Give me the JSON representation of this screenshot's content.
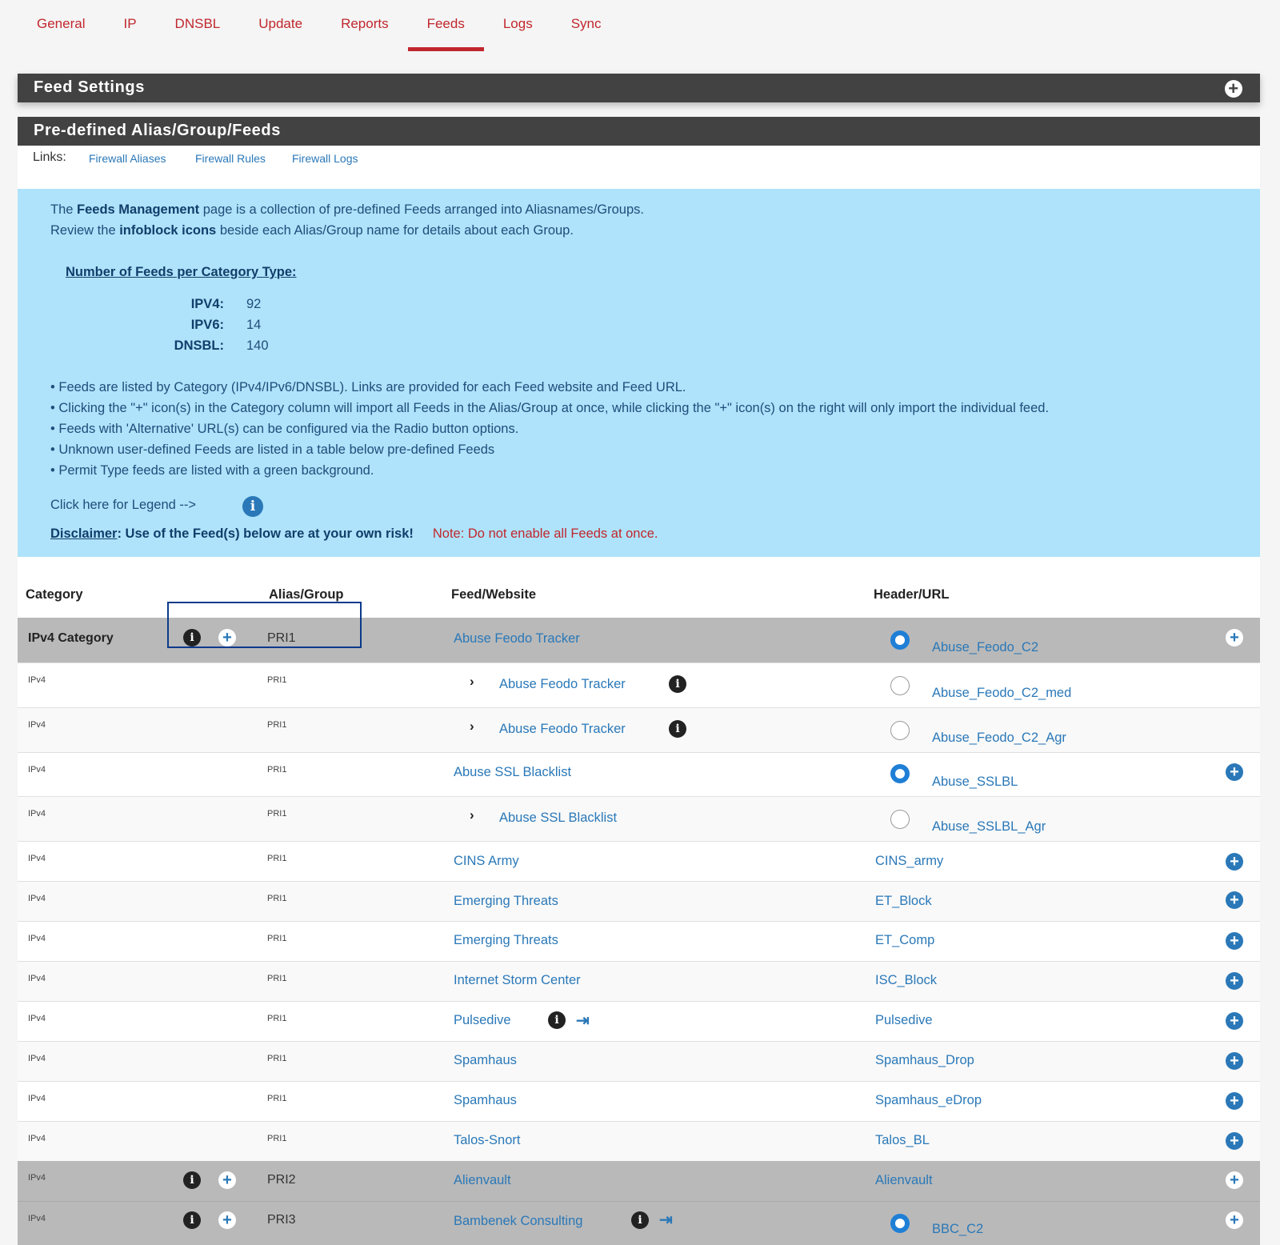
{
  "tabs": [
    {
      "label": "General",
      "active": false
    },
    {
      "label": "IP",
      "active": false
    },
    {
      "label": "DNSBL",
      "active": false
    },
    {
      "label": "Update",
      "active": false
    },
    {
      "label": "Reports",
      "active": false
    },
    {
      "label": "Feeds",
      "active": true
    },
    {
      "label": "Logs",
      "active": false
    },
    {
      "label": "Sync",
      "active": false
    }
  ],
  "feed_settings": {
    "title": "Feed Settings"
  },
  "predef": {
    "title": "Pre-defined Alias/Group/Feeds",
    "links_label": "Links:",
    "links": [
      "Firewall Aliases",
      "Firewall Rules",
      "Firewall Logs"
    ]
  },
  "info": {
    "l1a": "The ",
    "l1b": "Feeds Management",
    "l1c": " page is a collection of pre-defined Feeds arranged into Aliasnames/Groups.",
    "l2a": "Review the ",
    "l2b": "infoblock icons",
    "l2c": " beside each Alias/Group name for details about each Group.",
    "count_title": "Number of Feeds per Category Type:",
    "counts": [
      {
        "label": "IPV4:",
        "value": "92"
      },
      {
        "label": "IPV6:",
        "value": "14"
      },
      {
        "label": "DNSBL:",
        "value": "140"
      }
    ],
    "bullets": [
      "• Feeds are listed by Category (IPv4/IPv6/DNSBL). Links are provided for each Feed website and Feed URL.",
      "• Clicking the \"+\" icon(s) in the Category column will import all Feeds in the Alias/Group at once, while clicking the \"+\" icon(s) on the right will only import the individual feed.",
      "• Feeds with 'Alternative' URL(s) can be configured via the Radio button options.",
      "• Unknown user-defined Feeds are listed in a table below pre-defined Feeds",
      "• Permit Type feeds are listed with a green background."
    ],
    "legend": "Click here for Legend  -->",
    "disclaimer_a": "Disclaimer",
    "disclaimer_b": ": Use of the Feed(s) below are at your own risk!",
    "note": "Note: Do not enable all Feeds at once."
  },
  "table": {
    "headers": [
      "Category",
      "Alias/Group",
      "Feed/Website",
      "Header/URL"
    ],
    "rows": [
      {
        "category": "IPv4 Category",
        "group": "PRI1",
        "feed": "Abuse Feodo Tracker",
        "header": "Abuse_Feodo_C2"
      },
      {
        "category": "IPv4",
        "group": "PRI1",
        "feed": "Abuse Feodo Tracker",
        "header": "Abuse_Feodo_C2_med"
      },
      {
        "category": "IPv4",
        "group": "PRI1",
        "feed": "Abuse Feodo Tracker",
        "header": "Abuse_Feodo_C2_Agr"
      },
      {
        "category": "IPv4",
        "group": "PRI1",
        "feed": "Abuse SSL Blacklist",
        "header": "Abuse_SSLBL"
      },
      {
        "category": "IPv4",
        "group": "PRI1",
        "feed": "Abuse SSL Blacklist",
        "header": "Abuse_SSLBL_Agr"
      },
      {
        "category": "IPv4",
        "group": "PRI1",
        "feed": "CINS Army",
        "header": "CINS_army"
      },
      {
        "category": "IPv4",
        "group": "PRI1",
        "feed": "Emerging Threats",
        "header": "ET_Block"
      },
      {
        "category": "IPv4",
        "group": "PRI1",
        "feed": "Emerging Threats",
        "header": "ET_Comp"
      },
      {
        "category": "IPv4",
        "group": "PRI1",
        "feed": "Internet Storm Center",
        "header": "ISC_Block"
      },
      {
        "category": "IPv4",
        "group": "PRI1",
        "feed": "Pulsedive",
        "header": "Pulsedive"
      },
      {
        "category": "IPv4",
        "group": "PRI1",
        "feed": "Spamhaus",
        "header": "Spamhaus_Drop"
      },
      {
        "category": "IPv4",
        "group": "PRI1",
        "feed": "Spamhaus",
        "header": "Spamhaus_eDrop"
      },
      {
        "category": "IPv4",
        "group": "PRI1",
        "feed": "Talos-Snort",
        "header": "Talos_BL"
      },
      {
        "category": "IPv4",
        "group": "PRI2",
        "feed": "Alienvault",
        "header": "Alienvault"
      },
      {
        "category": "IPv4",
        "group": "PRI3",
        "feed": "Bambenek Consulting",
        "header": "BBC_C2"
      }
    ]
  }
}
